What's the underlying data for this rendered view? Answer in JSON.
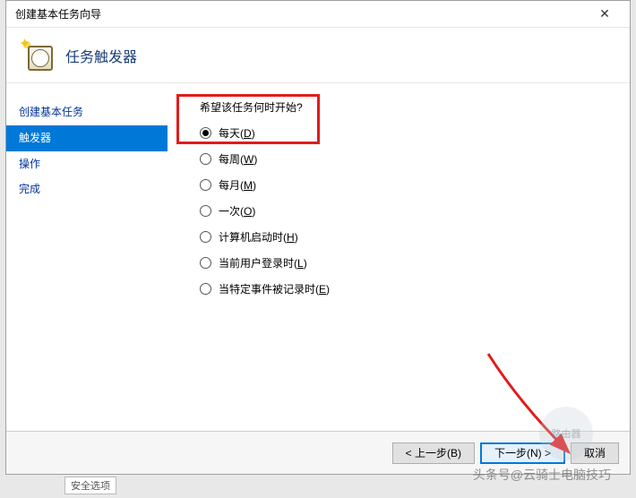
{
  "titlebar": {
    "title": "创建基本任务向导",
    "close": "✕"
  },
  "header": {
    "title": "任务触发器"
  },
  "sidebar": {
    "items": [
      {
        "label": "创建基本任务",
        "selected": false
      },
      {
        "label": "触发器",
        "selected": true
      },
      {
        "label": "操作",
        "selected": false
      },
      {
        "label": "完成",
        "selected": false
      }
    ]
  },
  "main": {
    "question": "希望该任务何时开始?",
    "options": [
      {
        "label": "每天",
        "accel": "D",
        "selected": true
      },
      {
        "label": "每周",
        "accel": "W",
        "selected": false
      },
      {
        "label": "每月",
        "accel": "M",
        "selected": false
      },
      {
        "label": "一次",
        "accel": "O",
        "selected": false
      },
      {
        "label": "计算机启动时",
        "accel": "H",
        "selected": false
      },
      {
        "label": "当前用户登录时",
        "accel": "L",
        "selected": false
      },
      {
        "label": "当特定事件被记录时",
        "accel": "E",
        "selected": false
      }
    ]
  },
  "footer": {
    "back": "< 上一步(B)",
    "next": "下一步(N) >",
    "cancel": "取消"
  },
  "watermark": {
    "text": "头条号@云骑士电脑技巧",
    "logo": "路由器"
  },
  "fragment": "安全选项"
}
